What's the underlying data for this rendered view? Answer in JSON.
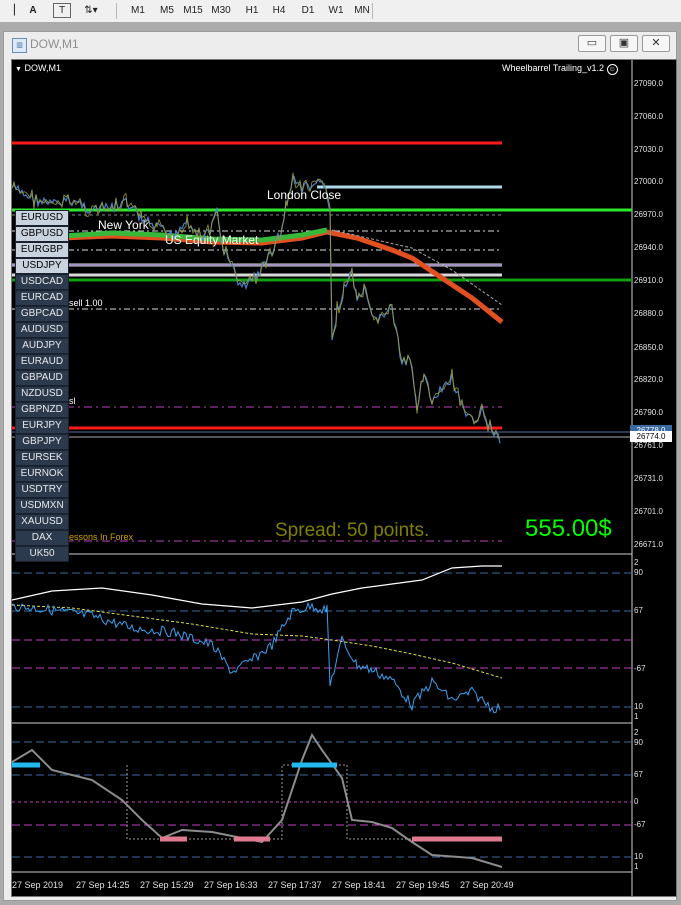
{
  "toolbar": {
    "tools": [
      "A",
      "T"
    ],
    "timeframes": [
      "M1",
      "M5",
      "M15",
      "M30",
      "H1",
      "H4",
      "D1",
      "W1",
      "MN"
    ]
  },
  "window": {
    "title": "DOW,M1",
    "minimize": "▭",
    "restore": "▣",
    "close": "✕"
  },
  "chart": {
    "symbol_label": "DOW,M1",
    "indicator_label": "Wheelbarrel Trailing_v1.2",
    "session_labels": [
      "London Close",
      "New York",
      "US Equity Market"
    ],
    "sell_label": "sell 1.00",
    "sl_label": "sl",
    "watermark": "Lessons In Forex",
    "spread_text": "Spread: 50 points.",
    "profit_text": "555.00$",
    "current_price": "26774.0",
    "ask_price": "26778.0",
    "symbols": [
      "EURUSD",
      "GBPUSD",
      "EURGBP",
      "USDJPY",
      "USDCAD",
      "EURCAD",
      "GBPCAD",
      "AUDUSD",
      "AUDJPY",
      "EURAUD",
      "GBPAUD",
      "NZDUSD",
      "GBPNZD",
      "EURJPY",
      "GBPJPY",
      "EURSEK",
      "EURNOK",
      "USDTRY",
      "USDMXN",
      "XAUUSD",
      "DAX",
      "UK50"
    ],
    "active_symbols": [
      "EURUSD",
      "GBPUSD",
      "EURGBP",
      "USDJPY"
    ],
    "price_axis": [
      "27090.0",
      "27060.0",
      "27030.0",
      "27000.0",
      "26970.0",
      "26940.0",
      "26910.0",
      "26880.0",
      "26850.0",
      "26820.0",
      "26790.0",
      "26761.0",
      "26731.0",
      "26701.0",
      "26671.0"
    ],
    "osc1_axis": [
      "2",
      "90",
      "67",
      "-67",
      "10",
      "1"
    ],
    "osc2_axis": [
      "2",
      "90",
      "67",
      "0",
      "-67",
      "10",
      "1"
    ],
    "time_axis": [
      "27 Sep 2019",
      "27 Sep 14:25",
      "27 Sep 15:29",
      "27 Sep 16:33",
      "27 Sep 17:37",
      "27 Sep 18:41",
      "27 Sep 19:45",
      "27 Sep 20:49"
    ]
  },
  "colors": {
    "chart_bg": "#000000",
    "bid_line": "#ff0000",
    "support_line": "#00ff00",
    "trail_line": "#e05020",
    "profit_text": "#00ff00",
    "spread_text": "#808000",
    "price_series": "#4a7fd0"
  }
}
